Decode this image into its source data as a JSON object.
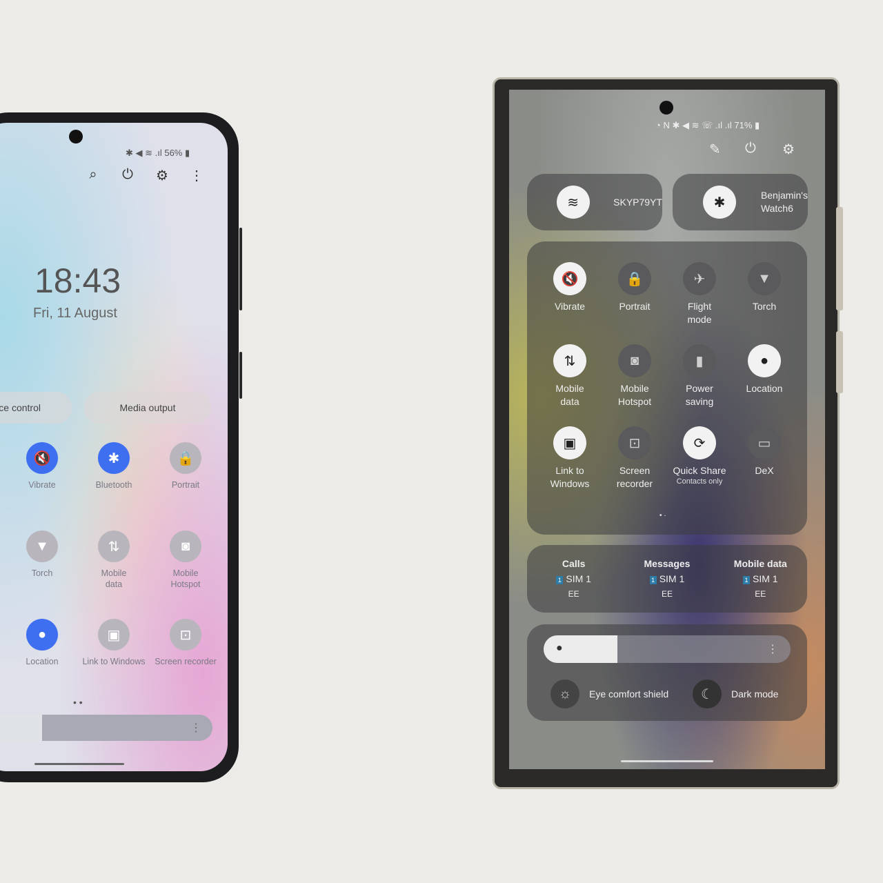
{
  "left_phone": {
    "status": {
      "battery": "56%"
    },
    "header_icons": [
      "search-icon",
      "power-icon",
      "gear-icon",
      "more-vert-icon"
    ],
    "clock": {
      "time": "18:43",
      "date": "Fri, 11 August"
    },
    "pills": [
      "ce control",
      "Media output"
    ],
    "tiles": [
      {
        "label": "Vibrate",
        "icon": "vibrate-icon",
        "glyph": "🔇",
        "active": true
      },
      {
        "label": "Bluetooth",
        "icon": "bluetooth-icon",
        "glyph": "✱",
        "active": true
      },
      {
        "label": "Portrait",
        "icon": "portrait-lock-icon",
        "glyph": "🔒",
        "active": false
      },
      {
        "label": "Torch",
        "icon": "torch-icon",
        "glyph": "▼",
        "active": false
      },
      {
        "label": "Mobile\ndata",
        "icon": "mobile-data-icon",
        "glyph": "⇅",
        "active": false
      },
      {
        "label": "Mobile\nHotspot",
        "icon": "hotspot-icon",
        "glyph": "◙",
        "active": false
      },
      {
        "label": "Location",
        "icon": "location-icon",
        "glyph": "●",
        "active": true
      },
      {
        "label": "Link to Windows",
        "icon": "link-to-windows-icon",
        "glyph": "▣",
        "active": false
      },
      {
        "label": "Screen recorder",
        "icon": "screen-recorder-icon",
        "glyph": "⊡",
        "active": false
      }
    ],
    "brightness": 0.27,
    "accent": "#3e6ff0"
  },
  "right_phone": {
    "status": {
      "battery": "71%"
    },
    "header_icons": [
      "edit-icon",
      "power-icon",
      "gear-icon"
    ],
    "wifi": {
      "name": "SKYP79YT"
    },
    "bluetooth": {
      "name": "Benjamin's\nWatch6"
    },
    "tiles": [
      {
        "label": "Vibrate",
        "icon": "vibrate-icon",
        "glyph": "🔇",
        "active": true
      },
      {
        "label": "Portrait",
        "icon": "portrait-lock-icon",
        "glyph": "🔒",
        "active": false
      },
      {
        "label": "Flight\nmode",
        "icon": "airplane-icon",
        "glyph": "✈",
        "active": false
      },
      {
        "label": "Torch",
        "icon": "torch-icon",
        "glyph": "▼",
        "active": false
      },
      {
        "label": "Mobile\ndata",
        "icon": "mobile-data-icon",
        "glyph": "⇅",
        "active": true
      },
      {
        "label": "Mobile\nHotspot",
        "icon": "hotspot-icon",
        "glyph": "◙",
        "active": false
      },
      {
        "label": "Power\nsaving",
        "icon": "power-saving-icon",
        "glyph": "▮",
        "active": false
      },
      {
        "label": "Location",
        "icon": "location-icon",
        "glyph": "●",
        "active": true
      },
      {
        "label": "Link to\nWindows",
        "icon": "link-to-windows-icon",
        "glyph": "▣",
        "active": true
      },
      {
        "label": "Screen\nrecorder",
        "icon": "screen-recorder-icon",
        "glyph": "⊡",
        "active": false
      },
      {
        "label": "Quick Share",
        "sub": "Contacts only",
        "icon": "quick-share-icon",
        "glyph": "⟳",
        "active": true
      },
      {
        "label": "DeX",
        "icon": "dex-icon",
        "glyph": "▭",
        "active": false
      }
    ],
    "sims": [
      {
        "title": "Calls",
        "sim": "SIM 1",
        "carrier": "EE"
      },
      {
        "title": "Messages",
        "sim": "SIM 1",
        "carrier": "EE"
      },
      {
        "title": "Mobile data",
        "sim": "SIM 1",
        "carrier": "EE"
      }
    ],
    "sim_number": "1",
    "brightness": 0.3,
    "eye_comfort": "Eye comfort shield",
    "dark_mode": "Dark mode"
  }
}
